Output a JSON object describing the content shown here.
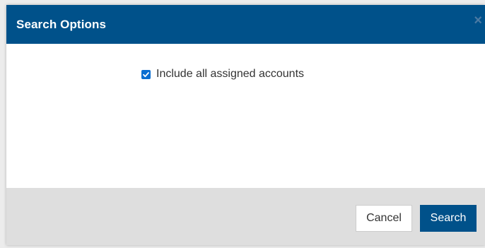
{
  "dialog": {
    "title": "Search Options",
    "close_glyph": "×",
    "colors": {
      "header": "#00518a",
      "footer": "#dedede",
      "checkbox": "#0a6ed1"
    }
  },
  "options": {
    "include_all_assigned": {
      "label": "Include all assigned accounts",
      "checked": true
    }
  },
  "footer": {
    "cancel_label": "Cancel",
    "search_label": "Search"
  }
}
